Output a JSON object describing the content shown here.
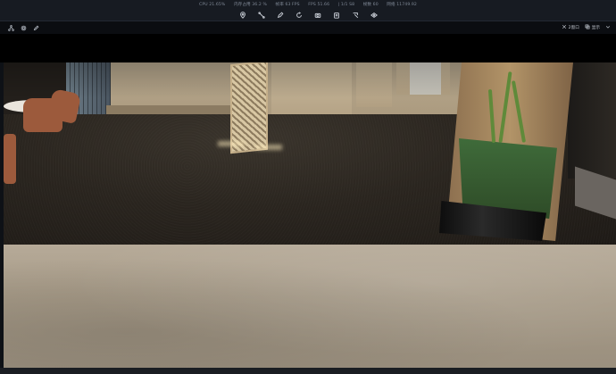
{
  "top_bar": {
    "stats": [
      "CPU 21.65%",
      "内存占用 36.2 %",
      "帧率 63 FPS",
      "FPS 51.66",
      "| 1/1 S8",
      "帧数 60",
      "网络 11749.92"
    ]
  },
  "toolbar": {
    "tools": [
      {
        "name": "location-pin-icon"
      },
      {
        "name": "measure-icon"
      },
      {
        "name": "draw-icon"
      },
      {
        "name": "rotate-icon"
      },
      {
        "name": "camera-icon"
      },
      {
        "name": "clipboard-icon"
      },
      {
        "name": "select-icon"
      },
      {
        "name": "view-icon"
      }
    ]
  },
  "sub_toolbar": {
    "left_icons": [
      {
        "name": "network-icon"
      },
      {
        "name": "settings-icon"
      },
      {
        "name": "edit-icon"
      }
    ],
    "right_buttons": [
      {
        "icon": "expand-icon",
        "label": "2窗口"
      },
      {
        "icon": "layers-icon",
        "label": "显示"
      },
      {
        "icon": "more-icon",
        "label": ""
      }
    ]
  },
  "colors": {
    "toolbar_bg": "#171b22",
    "scene_floor_dark": "#2a251f",
    "scene_floor_light": "#b6aa98"
  }
}
